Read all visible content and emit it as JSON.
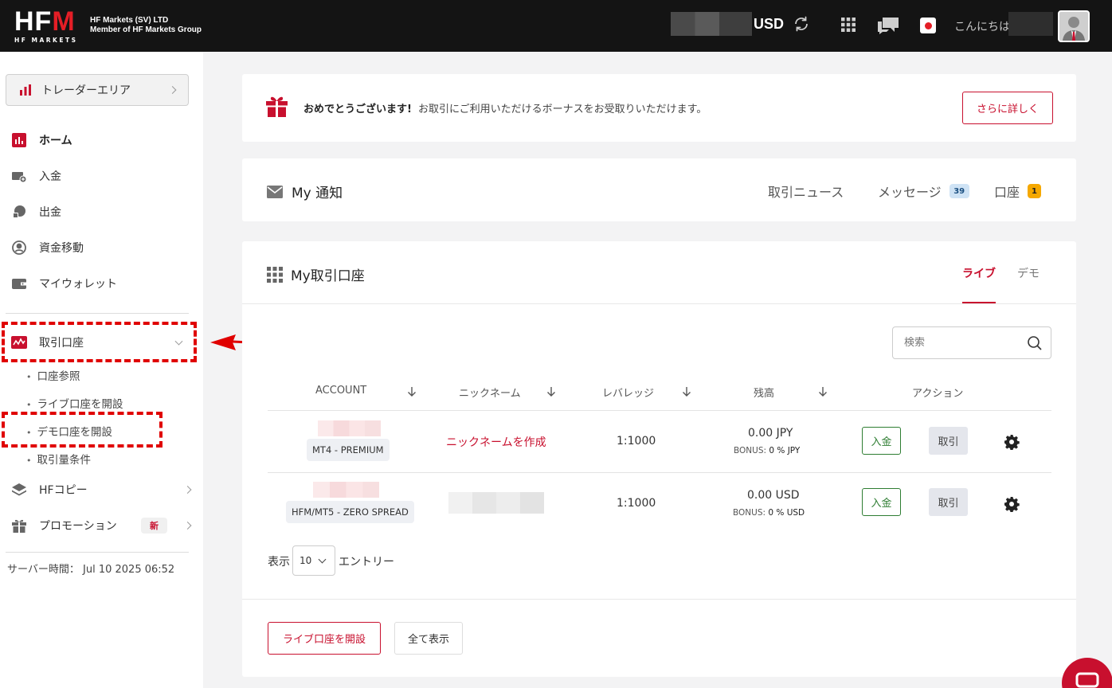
{
  "header": {
    "logo_main": "HFM",
    "logo_sub": "HF MARKETS",
    "company_line1": "HF Markets (SV) LTD",
    "company_line2": "Member of HF Markets Group",
    "currency": "USD",
    "greeting": "こんにちは"
  },
  "sidebar": {
    "trader_area": "トレーダーエリア",
    "items": [
      {
        "label": "ホーム",
        "icon": "chart-bar-icon"
      },
      {
        "label": "入金",
        "icon": "deposit-icon"
      },
      {
        "label": "出金",
        "icon": "withdraw-icon"
      },
      {
        "label": "資金移動",
        "icon": "transfer-icon"
      },
      {
        "label": "マイウォレット",
        "icon": "wallet-icon"
      },
      {
        "label": "取引口座",
        "icon": "trading-account-icon"
      },
      {
        "label": "HFコピー",
        "icon": "layers-icon"
      },
      {
        "label": "プロモーション",
        "icon": "gift-icon"
      }
    ],
    "sub_items": [
      "口座参照",
      "ライブ口座を開設",
      "デモ口座を開設",
      "取引量条件"
    ],
    "promo_badge": "新",
    "server_time_label": "サーバー時間：",
    "server_time": "Jul 10 2025 06:52"
  },
  "bonus_banner": {
    "headline": "おめでとうございます!",
    "text": "お取引にご利用いただけるボーナスをお受取りいただけます。",
    "button": "さらに詳しく"
  },
  "notifications": {
    "title": "My 通知",
    "tabs": [
      {
        "label": "取引ニュース"
      },
      {
        "label": "メッセージ",
        "count": "39"
      },
      {
        "label": "口座",
        "count": "1"
      }
    ]
  },
  "accounts": {
    "title": "My取引口座",
    "tab_live": "ライブ",
    "tab_demo": "デモ",
    "search_placeholder": "検索",
    "columns": [
      "ACCOUNT",
      "ニックネーム",
      "レバレッジ",
      "残高",
      "アクション"
    ],
    "rows": [
      {
        "type": "MT4 - PREMIUM",
        "nickname": "ニックネームを作成",
        "leverage": "1:1000",
        "balance": "0.00 JPY",
        "bonus_label": "BONUS:",
        "bonus": "0 % JPY",
        "deposit": "入金",
        "trade": "取引"
      },
      {
        "type": "HFM/MT5 - ZERO SPREAD",
        "nickname": "",
        "leverage": "1:1000",
        "balance": "0.00 USD",
        "bonus_label": "BONUS:",
        "bonus": "0 % USD",
        "deposit": "入金",
        "trade": "取引"
      }
    ],
    "show_label": "表示",
    "page_size": "10",
    "entries_label": "エントリー",
    "open_live_button": "ライブ口座を開設",
    "show_all_button": "全て表示"
  },
  "colors": {
    "brand_red": "#c8102e",
    "topbar": "#141414",
    "deposit_green": "#2e7d32",
    "annotation_red": "#e00000"
  }
}
